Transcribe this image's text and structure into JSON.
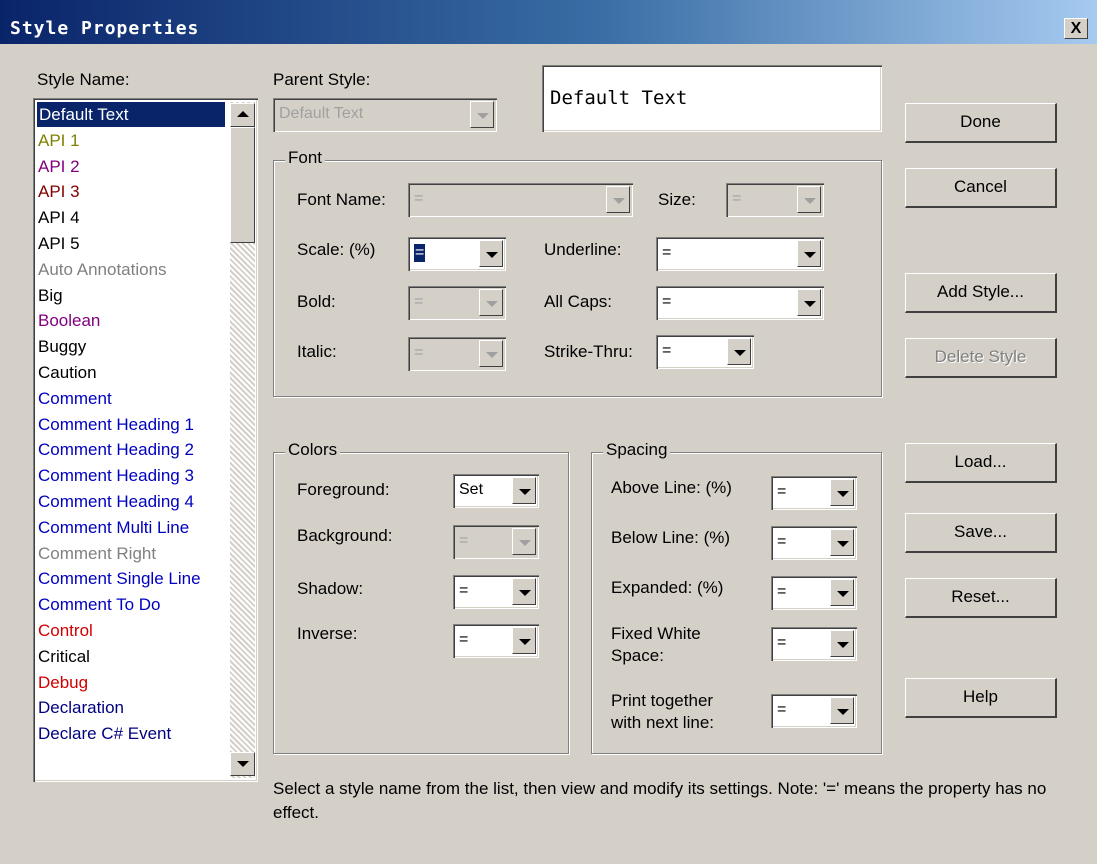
{
  "window": {
    "title": "Style Properties",
    "close_label": "X"
  },
  "style_name": {
    "label": "Style Name:",
    "items": [
      {
        "label": "Default Text",
        "color": "#ffffff",
        "selected": true
      },
      {
        "label": "API 1",
        "color": "#808000"
      },
      {
        "label": "API 2",
        "color": "#800080"
      },
      {
        "label": "API 3",
        "color": "#800000"
      },
      {
        "label": "API 4",
        "color": "#000000"
      },
      {
        "label": "API 5",
        "color": "#000000"
      },
      {
        "label": "Auto Annotations",
        "color": "#808080"
      },
      {
        "label": "Big",
        "color": "#000000"
      },
      {
        "label": "Boolean",
        "color": "#800080"
      },
      {
        "label": "Buggy",
        "color": "#000000"
      },
      {
        "label": "Caution",
        "color": "#000000"
      },
      {
        "label": "Comment",
        "color": "#0000c0"
      },
      {
        "label": "Comment Heading 1",
        "color": "#0000c0"
      },
      {
        "label": "Comment Heading 2",
        "color": "#0000c0"
      },
      {
        "label": "Comment Heading 3",
        "color": "#0000c0"
      },
      {
        "label": "Comment Heading 4",
        "color": "#0000c0"
      },
      {
        "label": "Comment Multi Line",
        "color": "#0000c0"
      },
      {
        "label": "Comment Right",
        "color": "#808080"
      },
      {
        "label": "Comment Single Line",
        "color": "#0000c0"
      },
      {
        "label": "Comment To Do",
        "color": "#0000c0"
      },
      {
        "label": "Control",
        "color": "#d00000"
      },
      {
        "label": "Critical",
        "color": "#000000"
      },
      {
        "label": "Debug",
        "color": "#d00000"
      },
      {
        "label": "Declaration",
        "color": "#000080"
      },
      {
        "label": "Declare C# Event",
        "color": "#000080"
      }
    ]
  },
  "parent_style": {
    "label": "Parent Style:",
    "value": "Default Text"
  },
  "preview": {
    "text": "Default Text"
  },
  "font": {
    "title": "Font",
    "font_name_label": "Font Name:",
    "font_name_value": "=",
    "size_label": "Size:",
    "size_value": "=",
    "scale_label": "Scale: (%)",
    "scale_value": "=",
    "underline_label": "Underline:",
    "underline_value": "=",
    "bold_label": "Bold:",
    "bold_value": "=",
    "allcaps_label": "All Caps:",
    "allcaps_value": "=",
    "italic_label": "Italic:",
    "italic_value": "=",
    "strike_label": "Strike-Thru:",
    "strike_value": "="
  },
  "colors": {
    "title": "Colors",
    "foreground_label": "Foreground:",
    "foreground_value": "Set",
    "background_label": "Background:",
    "background_value": "=",
    "shadow_label": "Shadow:",
    "shadow_value": "=",
    "inverse_label": "Inverse:",
    "inverse_value": "="
  },
  "spacing": {
    "title": "Spacing",
    "above_label": "Above Line: (%)",
    "above_value": "=",
    "below_label": "Below Line: (%)",
    "below_value": "=",
    "expanded_label": "Expanded: (%)",
    "expanded_value": "=",
    "fixed_label_1": "Fixed White",
    "fixed_label_2": "Space:",
    "fixed_value": "=",
    "print_label_1": "Print together",
    "print_label_2": "with next line:",
    "print_value": "="
  },
  "buttons": {
    "done": "Done",
    "cancel": "Cancel",
    "add_style": "Add Style...",
    "delete_style": "Delete Style",
    "load": "Load...",
    "save": "Save...",
    "reset": "Reset...",
    "help": "Help"
  },
  "footer": {
    "text": "Select a style name from the list, then view and modify its settings. Note: '=' means the property has no effect."
  }
}
